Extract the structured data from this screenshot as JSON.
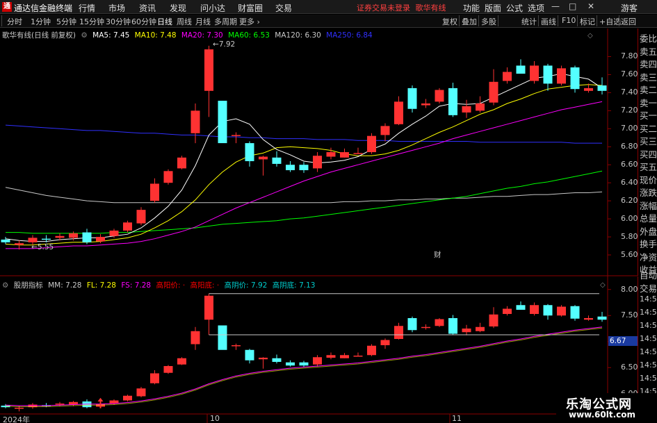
{
  "titlebar": {
    "logo": "通",
    "app_name": "通达信金融终端",
    "menus": [
      "行情",
      "市场",
      "资讯",
      "发现",
      "问小达",
      "财富圈",
      "交易"
    ],
    "warning": "证券交易未登录",
    "stock_name_title": "歌华有线",
    "right_menus": [
      "功能",
      "版面",
      "公式",
      "选项"
    ],
    "user": "游客"
  },
  "toolbar": {
    "periods": [
      "分时",
      "1分钟",
      "5分钟",
      "15分钟",
      "30分钟",
      "60分钟",
      "日线",
      "周线",
      "月线",
      "多周期",
      "更多"
    ],
    "active_period": "日线",
    "right_tools": [
      "复权",
      "叠加",
      "多股",
      "统计",
      "画线",
      "F10",
      "标记",
      "+自选",
      "返回"
    ]
  },
  "main_legend": {
    "title": "歌华有线(日线 前复权)",
    "ma": [
      {
        "label": "MA5: 7.45",
        "color": "#ffffff"
      },
      {
        "label": "MA10: 7.48",
        "color": "#ffff00"
      },
      {
        "label": "MA20: 7.30",
        "color": "#ff00ff"
      },
      {
        "label": "MA60: 6.53",
        "color": "#00ff00"
      },
      {
        "label": "MA120: 6.30",
        "color": "#c8c8c8"
      },
      {
        "label": "MA250: 6.84",
        "color": "#3030ff"
      }
    ]
  },
  "main_annotations": {
    "high": "7.92",
    "low": "5.55",
    "marker": "财"
  },
  "main_axis": [
    "7.80",
    "7.60",
    "7.40",
    "7.20",
    "7.00",
    "6.80",
    "6.60",
    "6.40",
    "6.20",
    "6.00",
    "5.80",
    "5.60"
  ],
  "right_info": [
    "委比",
    "卖五",
    "卖四",
    "卖三",
    "卖二",
    "卖一",
    "买一",
    "买二",
    "买三",
    "买四",
    "买五",
    "现价",
    "涨跌",
    "涨幅",
    "总量",
    "外盘",
    "换手",
    "净资",
    "收益"
  ],
  "sub_legend": {
    "title": "股朋指标",
    "items": [
      {
        "label": "MM: 7.28",
        "color": "#c8c8c8"
      },
      {
        "label": "FL: 7.28",
        "color": "#ffff00"
      },
      {
        "label": "FS: 7.28",
        "color": "#ff00ff"
      },
      {
        "label": "高阳价: ·",
        "color": "#ff0000"
      },
      {
        "label": "高阳底: ·",
        "color": "#ff0000"
      },
      {
        "label": "高阴价: 7.92",
        "color": "#00cccc"
      },
      {
        "label": "高阴底: 7.13",
        "color": "#00cccc"
      }
    ]
  },
  "sub_axis": [
    "8.00",
    "7.50",
    "7.00",
    "6.50",
    "6.00"
  ],
  "sub_current": "6.67",
  "right_info2": [
    "自动",
    "交易",
    "14:56",
    "14:56",
    "14:56",
    "14:56",
    "14:56",
    "14:56",
    "14:56",
    "14:56",
    "14:56"
  ],
  "dates": [
    "2024年",
    "10",
    "11"
  ],
  "watermark": {
    "line1": "乐淘公式网",
    "line2": "www.60lt.com"
  },
  "colors": {
    "up": "#ff3232",
    "down": "#54ffff",
    "ma5": "#ffffff",
    "ma10": "#ffff00",
    "ma20": "#ff00ff",
    "ma60": "#00ff00",
    "ma120": "#c8c8c8",
    "ma250": "#3030ff"
  },
  "chart_data": {
    "type": "candlestick",
    "ylim": [
      5.5,
      7.95
    ],
    "candles": [
      {
        "o": 5.77,
        "h": 5.8,
        "l": 5.72,
        "c": 5.74
      },
      {
        "o": 5.71,
        "h": 5.76,
        "l": 5.66,
        "c": 5.73
      },
      {
        "o": 5.74,
        "h": 5.82,
        "l": 5.71,
        "c": 5.79
      },
      {
        "o": 5.78,
        "h": 5.82,
        "l": 5.74,
        "c": 5.77
      },
      {
        "o": 5.79,
        "h": 5.84,
        "l": 5.76,
        "c": 5.81
      },
      {
        "o": 5.79,
        "h": 5.86,
        "l": 5.76,
        "c": 5.84
      },
      {
        "o": 5.85,
        "h": 5.89,
        "l": 5.72,
        "c": 5.74
      },
      {
        "o": 5.75,
        "h": 5.83,
        "l": 5.73,
        "c": 5.8
      },
      {
        "o": 5.81,
        "h": 5.89,
        "l": 5.79,
        "c": 5.87
      },
      {
        "o": 5.87,
        "h": 5.98,
        "l": 5.85,
        "c": 5.96
      },
      {
        "o": 5.95,
        "h": 6.13,
        "l": 5.93,
        "c": 6.1
      },
      {
        "o": 6.2,
        "h": 6.45,
        "l": 6.18,
        "c": 6.39
      },
      {
        "o": 6.4,
        "h": 6.55,
        "l": 6.38,
        "c": 6.53
      },
      {
        "o": 6.56,
        "h": 6.7,
        "l": 6.55,
        "c": 6.68
      },
      {
        "o": 6.95,
        "h": 7.28,
        "l": 6.84,
        "c": 7.2
      },
      {
        "o": 7.42,
        "h": 7.92,
        "l": 7.13,
        "c": 7.88
      },
      {
        "o": 7.31,
        "h": 7.31,
        "l": 6.95,
        "c": 6.84
      },
      {
        "o": 6.92,
        "h": 6.96,
        "l": 6.84,
        "c": 6.93
      },
      {
        "o": 6.84,
        "h": 6.86,
        "l": 6.58,
        "c": 6.64
      },
      {
        "o": 6.66,
        "h": 6.7,
        "l": 6.48,
        "c": 6.69
      },
      {
        "o": 6.68,
        "h": 6.75,
        "l": 6.58,
        "c": 6.61
      },
      {
        "o": 6.6,
        "h": 6.64,
        "l": 6.52,
        "c": 6.54
      },
      {
        "o": 6.6,
        "h": 6.63,
        "l": 6.51,
        "c": 6.54
      },
      {
        "o": 6.56,
        "h": 6.74,
        "l": 6.52,
        "c": 6.7
      },
      {
        "o": 6.69,
        "h": 6.79,
        "l": 6.66,
        "c": 6.74
      },
      {
        "o": 6.68,
        "h": 6.78,
        "l": 6.68,
        "c": 6.74
      },
      {
        "o": 6.73,
        "h": 6.79,
        "l": 6.72,
        "c": 6.73
      },
      {
        "o": 6.74,
        "h": 6.95,
        "l": 6.72,
        "c": 6.92
      },
      {
        "o": 6.93,
        "h": 7.06,
        "l": 6.86,
        "c": 7.03
      },
      {
        "o": 7.05,
        "h": 7.36,
        "l": 7.04,
        "c": 7.3
      },
      {
        "o": 7.45,
        "h": 7.48,
        "l": 7.18,
        "c": 7.22
      },
      {
        "o": 7.26,
        "h": 7.33,
        "l": 7.23,
        "c": 7.28
      },
      {
        "o": 7.3,
        "h": 7.45,
        "l": 7.28,
        "c": 7.43
      },
      {
        "o": 7.45,
        "h": 7.51,
        "l": 7.13,
        "c": 7.15
      },
      {
        "o": 7.18,
        "h": 7.32,
        "l": 7.12,
        "c": 7.25
      },
      {
        "o": 7.2,
        "h": 7.36,
        "l": 7.18,
        "c": 7.28
      },
      {
        "o": 7.29,
        "h": 7.66,
        "l": 7.26,
        "c": 7.52
      },
      {
        "o": 7.53,
        "h": 7.68,
        "l": 7.5,
        "c": 7.63
      },
      {
        "o": 7.7,
        "h": 7.77,
        "l": 7.62,
        "c": 7.61
      },
      {
        "o": 7.53,
        "h": 7.75,
        "l": 7.5,
        "c": 7.7
      },
      {
        "o": 7.7,
        "h": 7.72,
        "l": 7.42,
        "c": 7.5
      },
      {
        "o": 7.5,
        "h": 7.7,
        "l": 7.48,
        "c": 7.67
      },
      {
        "o": 7.68,
        "h": 7.7,
        "l": 7.4,
        "c": 7.44
      },
      {
        "o": 7.42,
        "h": 7.5,
        "l": 7.4,
        "c": 7.45
      },
      {
        "o": 7.48,
        "h": 7.57,
        "l": 7.38,
        "c": 7.42
      }
    ],
    "ma": {
      "ma5": [
        5.78,
        5.76,
        5.75,
        5.75,
        5.77,
        5.78,
        5.79,
        5.79,
        5.81,
        5.83,
        5.9,
        6.01,
        6.14,
        6.32,
        6.59,
        6.93,
        7.08,
        7.11,
        7.05,
        6.88,
        6.77,
        6.71,
        6.64,
        6.62,
        6.63,
        6.65,
        6.69,
        6.77,
        6.83,
        6.95,
        7.05,
        7.14,
        7.25,
        7.28,
        7.27,
        7.28,
        7.35,
        7.42,
        7.49,
        7.56,
        7.58,
        7.61,
        7.58,
        7.55,
        7.45
      ],
      "ma10": [
        5.72,
        5.71,
        5.71,
        5.72,
        5.73,
        5.74,
        5.74,
        5.75,
        5.77,
        5.79,
        5.83,
        5.9,
        5.98,
        6.08,
        6.21,
        6.38,
        6.52,
        6.63,
        6.7,
        6.73,
        6.79,
        6.8,
        6.79,
        6.78,
        6.76,
        6.72,
        6.7,
        6.7,
        6.72,
        6.76,
        6.82,
        6.89,
        6.96,
        7.02,
        7.09,
        7.16,
        7.21,
        7.28,
        7.33,
        7.39,
        7.44,
        7.46,
        7.48,
        7.49,
        7.48
      ],
      "ma20": [
        5.67,
        5.67,
        5.67,
        5.68,
        5.69,
        5.7,
        5.7,
        5.71,
        5.72,
        5.73,
        5.75,
        5.78,
        5.82,
        5.86,
        5.91,
        5.98,
        6.05,
        6.12,
        6.18,
        6.24,
        6.3,
        6.36,
        6.42,
        6.47,
        6.52,
        6.56,
        6.6,
        6.64,
        6.68,
        6.72,
        6.76,
        6.8,
        6.84,
        6.89,
        6.93,
        6.97,
        7.01,
        7.05,
        7.09,
        7.13,
        7.17,
        7.21,
        7.24,
        7.27,
        7.3
      ],
      "ma60": [
        5.85,
        5.85,
        5.84,
        5.84,
        5.84,
        5.84,
        5.84,
        5.84,
        5.85,
        5.85,
        5.86,
        5.87,
        5.88,
        5.89,
        5.9,
        5.92,
        5.94,
        5.95,
        5.96,
        5.97,
        5.98,
        6.0,
        6.01,
        6.03,
        6.05,
        6.07,
        6.09,
        6.11,
        6.13,
        6.15,
        6.17,
        6.19,
        6.21,
        6.23,
        6.25,
        6.28,
        6.31,
        6.34,
        6.36,
        6.39,
        6.41,
        6.44,
        6.47,
        6.5,
        6.53
      ],
      "ma120": [
        6.35,
        6.32,
        6.29,
        6.26,
        6.24,
        6.22,
        6.2,
        6.19,
        6.18,
        6.18,
        6.18,
        6.18,
        6.18,
        6.18,
        6.18,
        6.18,
        6.18,
        6.18,
        6.18,
        6.18,
        6.18,
        6.18,
        6.18,
        6.18,
        6.18,
        6.19,
        6.19,
        6.2,
        6.2,
        6.21,
        6.21,
        6.22,
        6.22,
        6.23,
        6.23,
        6.24,
        6.25,
        6.25,
        6.26,
        6.27,
        6.27,
        6.28,
        6.29,
        6.29,
        6.3
      ],
      "ma250": [
        7.04,
        7.03,
        7.02,
        7.01,
        7.0,
        6.99,
        6.98,
        6.98,
        6.97,
        6.96,
        6.95,
        6.95,
        6.94,
        6.93,
        6.93,
        6.92,
        6.91,
        6.91,
        6.9,
        6.9,
        6.89,
        6.89,
        6.89,
        6.88,
        6.88,
        6.88,
        6.87,
        6.87,
        6.87,
        6.86,
        6.86,
        6.86,
        6.86,
        6.86,
        6.86,
        6.85,
        6.85,
        6.85,
        6.85,
        6.85,
        6.85,
        6.85,
        6.84,
        6.84,
        6.84
      ]
    },
    "sub_ylim": [
      5.85,
      8.25
    ],
    "sub_ma": [
      5.78,
      5.77,
      5.77,
      5.77,
      5.78,
      5.79,
      5.8,
      5.8,
      5.81,
      5.83,
      5.86,
      5.9,
      5.95,
      6.01,
      6.09,
      6.19,
      6.27,
      6.34,
      6.39,
      6.43,
      6.46,
      6.49,
      6.51,
      6.53,
      6.55,
      6.57,
      6.59,
      6.62,
      6.65,
      6.68,
      6.72,
      6.75,
      6.79,
      6.83,
      6.87,
      6.91,
      6.96,
      7.01,
      7.05,
      7.1,
      7.14,
      7.18,
      7.22,
      7.25,
      7.28
    ],
    "sub_hlines": [
      7.92,
      7.13
    ],
    "sub_arrow_index": 7
  }
}
